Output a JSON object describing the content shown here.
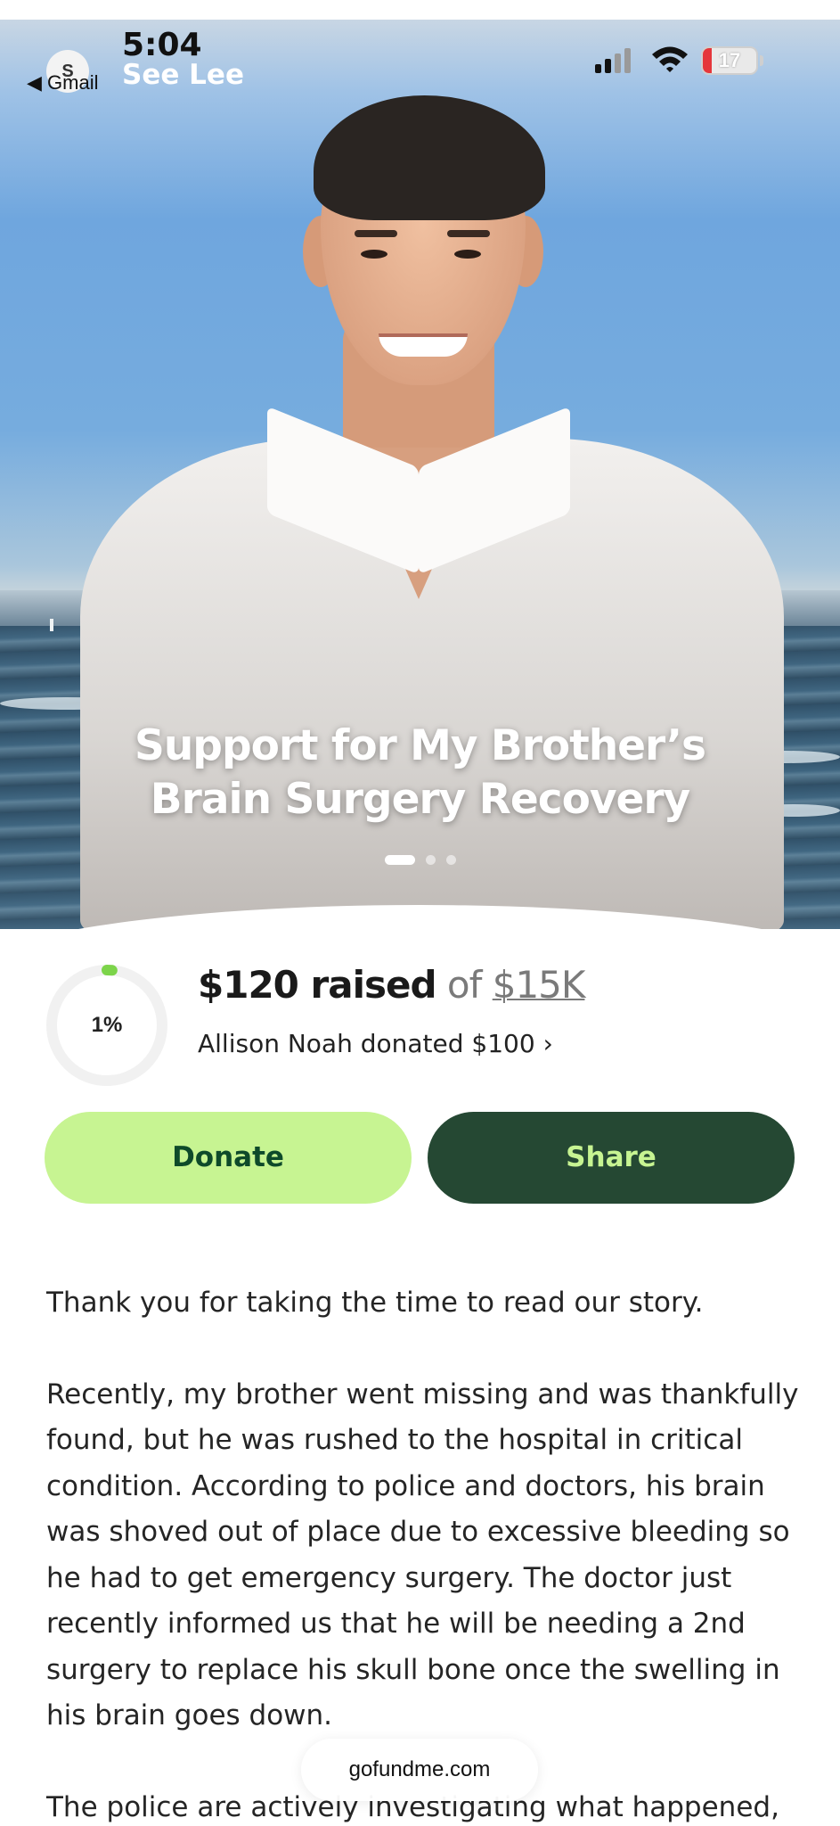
{
  "status_bar": {
    "time": "5:04",
    "back_app": "◀ Gmail",
    "back_avatar_letter": "S",
    "contact_name": "See Lee",
    "battery_level": "17",
    "battery_color": "#e5373b",
    "signal_bars_active": 2,
    "signal_bars_total": 4
  },
  "hero": {
    "title_line1": "Support for My Brother’s",
    "title_line2": "Brain Surgery Recovery",
    "carousel_count": 3,
    "carousel_active": 0
  },
  "fundraiser": {
    "percent_label": "1%",
    "percent_value": 0.01,
    "raised_amount": "$120 raised",
    "of_text": " of ",
    "goal": "$15K",
    "latest_donation": "Allison Noah donated $100 ›",
    "accent_color": "#7cd44a"
  },
  "actions": {
    "donate_label": "Donate",
    "share_label": "Share",
    "donate_color": "#c7f492",
    "share_color": "#254833"
  },
  "story": {
    "paragraphs": [
      "Thank you for taking the time to read our story.",
      "Recently, my brother went missing and was thankfully found, but he was rushed to the hospital in critical condition. According to police and doctors, his brain was shoved out of place due to excessive bleeding so he had to get emergency surgery. The doctor just recently informed us that he will be needing a 2nd surgery to replace his skull bone once the swelling in his brain goes down.",
      "The police are actively investigating what happened,"
    ]
  },
  "browser": {
    "url": "gofundme.com"
  }
}
